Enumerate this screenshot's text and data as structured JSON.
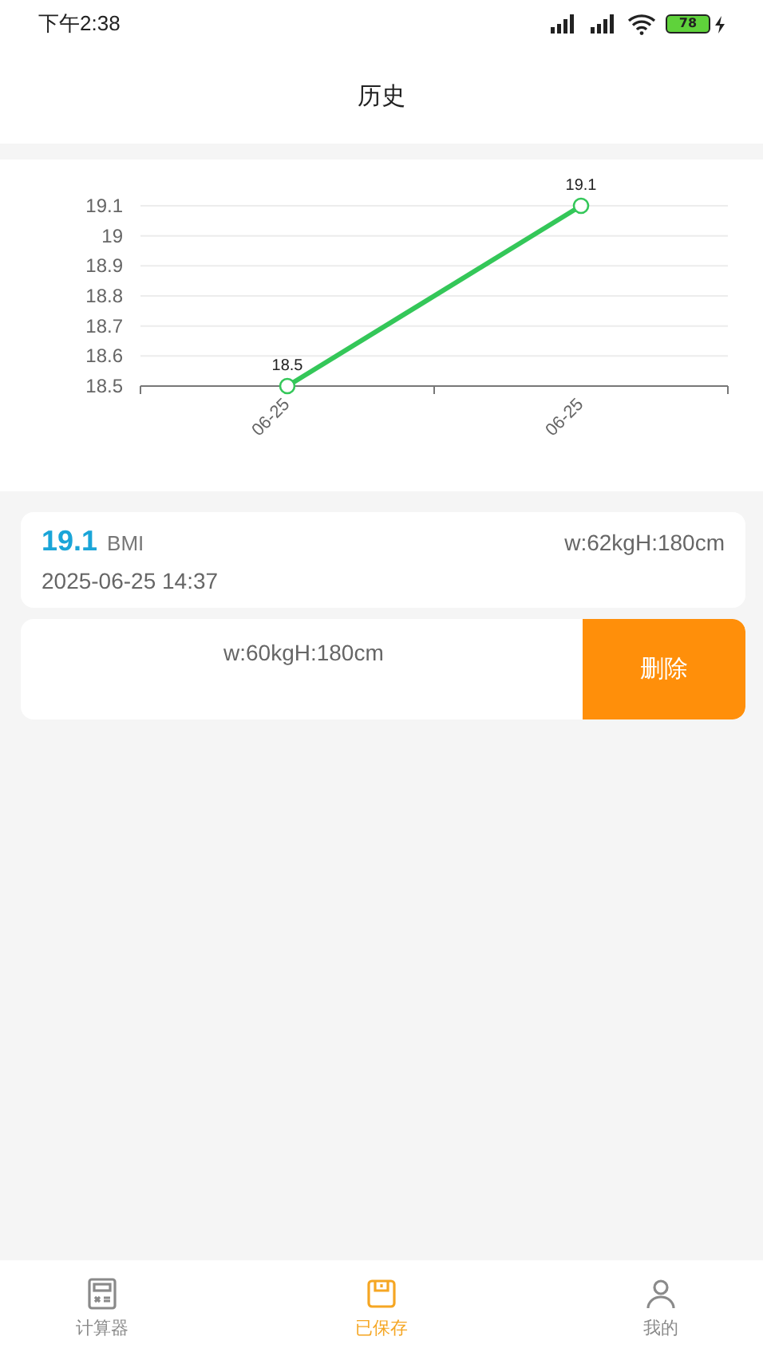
{
  "status_bar": {
    "time": "下午2:38",
    "battery": "78"
  },
  "header": {
    "title": "历史"
  },
  "chart": {
    "chart_data": {
      "type": "line",
      "categories": [
        "06-25",
        "06-25"
      ],
      "series": [
        {
          "color": "#34c759",
          "marker": "circle",
          "values": [
            18.5,
            19.1
          ]
        }
      ],
      "grid": true,
      "ylim": [
        18.5,
        19.1
      ],
      "yticks": [
        18.5,
        18.6,
        18.7,
        18.8,
        18.9,
        {
          "value": 19,
          "label": "19"
        },
        19.1
      ],
      "data_labels": true
    }
  },
  "records": [
    {
      "kind": "full",
      "bmi": "19.1",
      "unit": "BMI",
      "measure": "w:62kgH:180cm",
      "date": "2025-06-25 14:37"
    },
    {
      "kind": "swiped",
      "measure": "w:60kgH:180cm",
      "action": "删除"
    }
  ],
  "tabs": [
    {
      "label": "计算器",
      "kind": "calculator",
      "selected": false
    },
    {
      "label": "已保存",
      "kind": "saved",
      "selected": true
    },
    {
      "label": "我的",
      "kind": "person",
      "selected": false
    }
  ]
}
